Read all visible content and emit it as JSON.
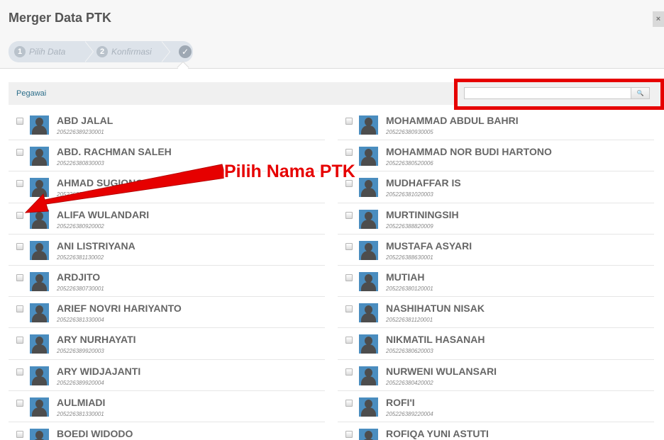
{
  "header": {
    "title": "Merger Data PTK",
    "close_icon": "close-icon",
    "close_glyph": "×"
  },
  "wizard": {
    "steps": [
      {
        "number": "1",
        "label": "Pilih Data"
      },
      {
        "number": "2",
        "label": "Konfirmasi"
      },
      {
        "icon": "check-icon",
        "glyph": "✓"
      }
    ]
  },
  "filter": {
    "label": "Pegawai",
    "search_value": "",
    "search_icon": "search-icon",
    "search_glyph": "🔍"
  },
  "annotation": {
    "label": "Pilih Nama PTK",
    "color": "#e60000"
  },
  "employees_left": [
    {
      "name": "ABD JALAL",
      "nip": "205226389230001"
    },
    {
      "name": "ABD. RACHMAN SALEH",
      "nip": "205226380830003"
    },
    {
      "name": "AHMAD SUGIONO",
      "nip": "205226381"
    },
    {
      "name": "ALIFA WULANDARI",
      "nip": "205226380920002"
    },
    {
      "name": "ANI LISTRIYANA",
      "nip": "205226381130002"
    },
    {
      "name": "ARDJITO",
      "nip": "205226380730001"
    },
    {
      "name": "ARIEF NOVRI HARIYANTO",
      "nip": "205226381330004"
    },
    {
      "name": "ARY NURHAYATI",
      "nip": "205226389920003"
    },
    {
      "name": "ARY WIDJAJANTI",
      "nip": "205226389920004"
    },
    {
      "name": "AULMIADI",
      "nip": "205226381330001"
    },
    {
      "name": "BOEDI WIDODO",
      "nip": ""
    }
  ],
  "employees_right": [
    {
      "name": "MOHAMMAD ABDUL BAHRI",
      "nip": "205226380930005"
    },
    {
      "name": "MOHAMMAD NOR BUDI HARTONO",
      "nip": "205226380520006"
    },
    {
      "name": "MUDHAFFAR IS",
      "nip": "205226381020003"
    },
    {
      "name": "MURTININGSIH",
      "nip": "205226388820009"
    },
    {
      "name": "MUSTAFA ASYARI",
      "nip": "205226388630001"
    },
    {
      "name": "MUTIAH",
      "nip": "205226380120001"
    },
    {
      "name": "NASHIHATUN NISAK",
      "nip": "205226381120001"
    },
    {
      "name": "NIKMATIL HASANAH",
      "nip": "205226380620003"
    },
    {
      "name": "NURWENI WULANSARI",
      "nip": "205226380420002"
    },
    {
      "name": "ROFI'I",
      "nip": "205226389220004"
    },
    {
      "name": "ROFIQA YUNI ASTUTI",
      "nip": ""
    }
  ]
}
